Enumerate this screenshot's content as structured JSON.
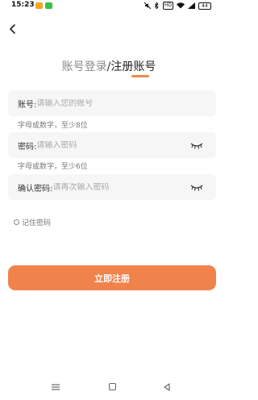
{
  "status_bar": {
    "time": "15:23",
    "hd": "HD",
    "battery": "44"
  },
  "title": {
    "login": "账号登录",
    "separator": "/",
    "register": "注册账号"
  },
  "form": {
    "account": {
      "label": "账号:",
      "placeholder": "请输入您的账号",
      "hint": "字母或数字，至少8位"
    },
    "password": {
      "label": "密码:",
      "placeholder": "请输入密码",
      "hint": "字母或数字，至少6位"
    },
    "confirm": {
      "label": "确认密码:",
      "placeholder": "请再次输入密码"
    },
    "remember_label": "记住密码",
    "submit_label": "立即注册"
  },
  "colors": {
    "accent": "#f0834b",
    "field_bg": "#f6f6f6"
  },
  "icons": {
    "back": "arrow-left-icon",
    "eye": "eye-closed-icon",
    "radio": "radio-unchecked-icon"
  }
}
